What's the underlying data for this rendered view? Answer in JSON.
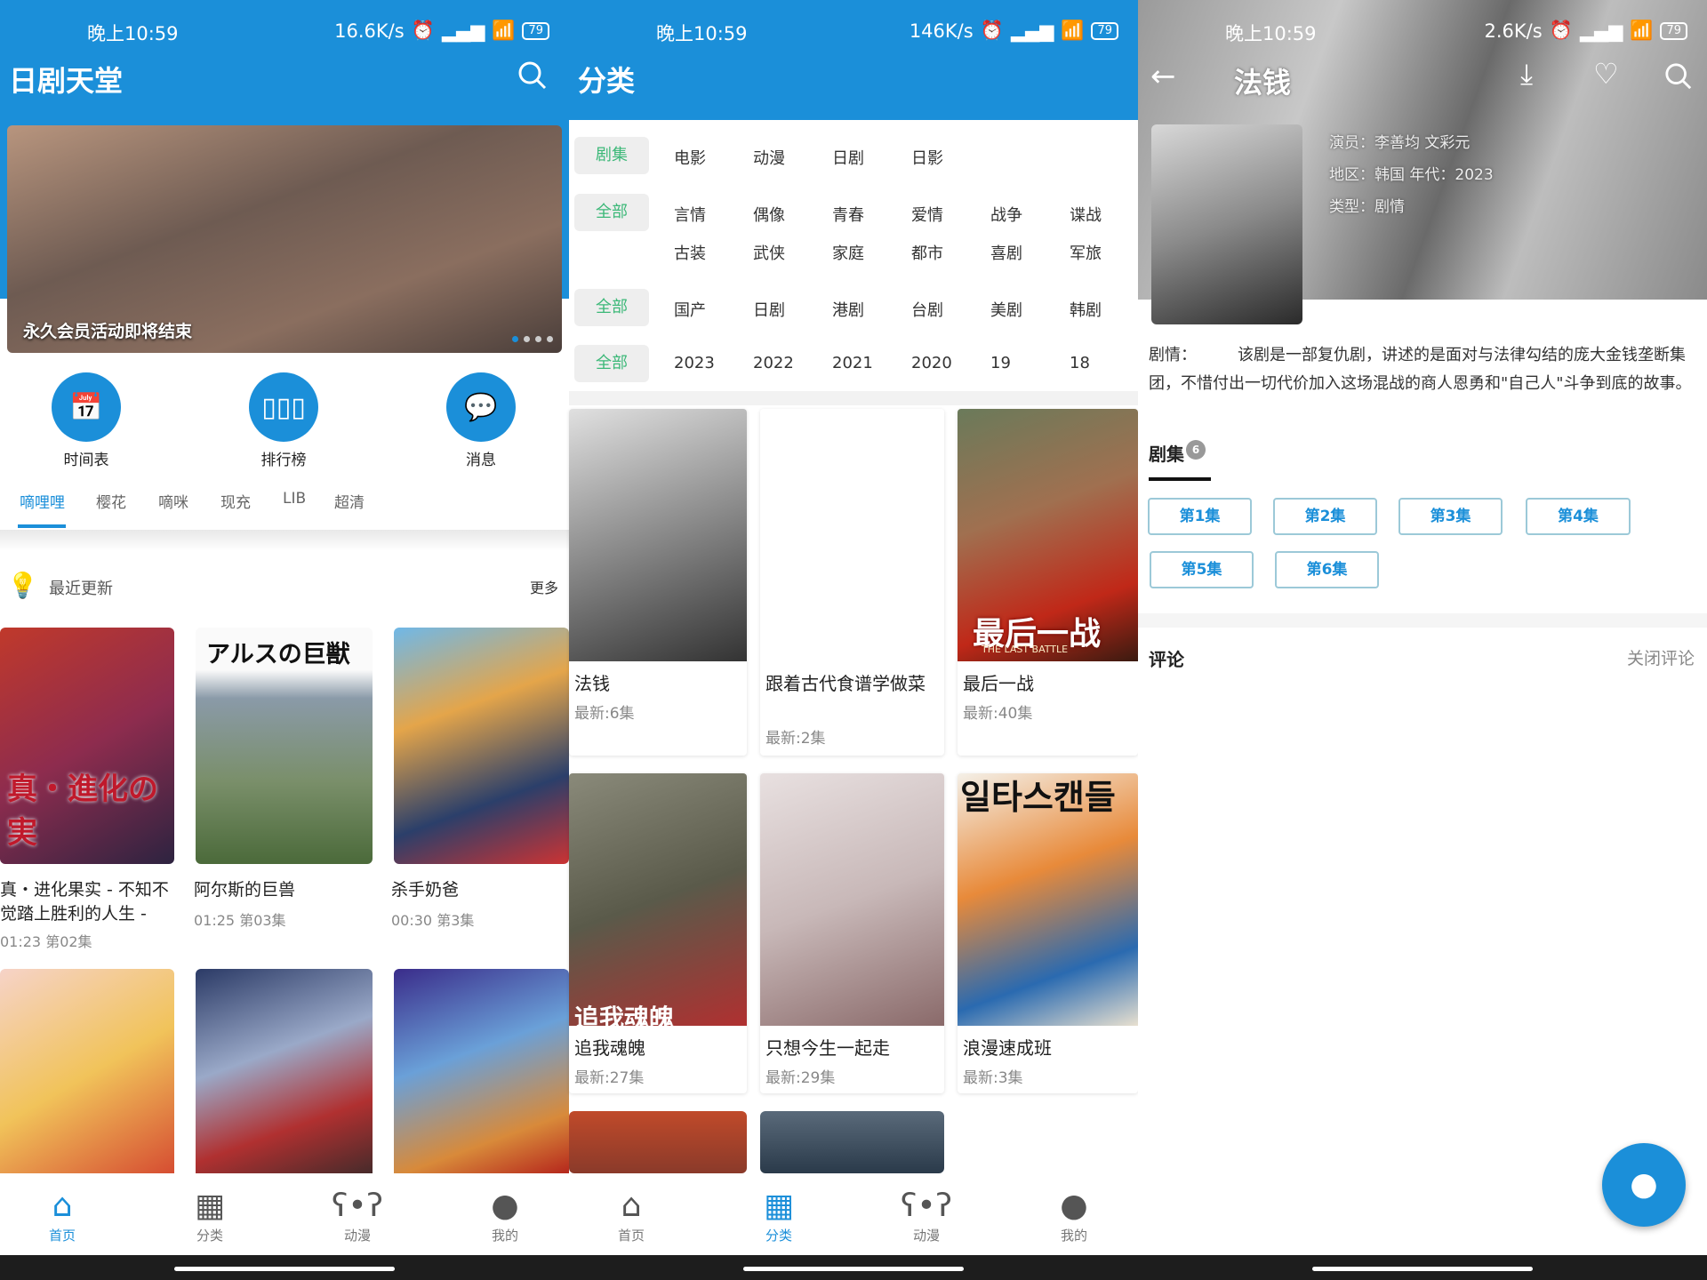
{
  "status": [
    {
      "time": "晚上10:59",
      "speed": "16.6K/s",
      "battery": "79"
    },
    {
      "time": "晚上10:59",
      "speed": "146K/s",
      "battery": "79"
    },
    {
      "time": "晚上10:59",
      "speed": "2.6K/s",
      "battery": "79"
    }
  ],
  "home": {
    "title": "日剧天堂",
    "banner_caption": "永久会员活动即将结束",
    "banner_dots": 4,
    "quick": [
      {
        "label": "时间表",
        "icon": "calendar-icon"
      },
      {
        "label": "排行榜",
        "icon": "chart-icon"
      },
      {
        "label": "消息",
        "icon": "message-icon"
      }
    ],
    "source_tabs": [
      "嘀哩哩",
      "樱花",
      "嘀咪",
      "现充",
      "LIB",
      "超清"
    ],
    "active_tab": "嘀哩哩",
    "section_title": "最近更新",
    "more": "更多",
    "items": [
      {
        "title": "真・进化果实 - 不知不觉踏上胜利的人生 -",
        "meta": "01:23 第02集"
      },
      {
        "title": "阿尔斯的巨兽",
        "meta": "01:25 第03集"
      },
      {
        "title": "杀手奶爸",
        "meta": "00:30 第3集"
      }
    ],
    "poster_text": [
      "真・進化の実",
      "アルスの巨獣"
    ]
  },
  "nav": [
    {
      "label": "首页",
      "icon": "home-icon"
    },
    {
      "label": "分类",
      "icon": "grid-icon"
    },
    {
      "label": "动漫",
      "icon": "bear-icon"
    },
    {
      "label": "我的",
      "icon": "user-icon"
    }
  ],
  "category": {
    "title": "分类",
    "rows": [
      {
        "chip": "剧集",
        "options": [
          "电影",
          "动漫",
          "日剧",
          "日影"
        ]
      },
      {
        "chip": "全部",
        "options": [
          "言情",
          "偶像",
          "青春",
          "爱情",
          "战争",
          "谍战",
          "古装",
          "武侠",
          "家庭",
          "都市",
          "喜剧",
          "军旅"
        ]
      },
      {
        "chip": "全部",
        "options": [
          "国产",
          "日剧",
          "港剧",
          "台剧",
          "美剧",
          "韩剧"
        ]
      },
      {
        "chip": "全部",
        "options": [
          "2023",
          "2022",
          "2021",
          "2020",
          "19",
          "18"
        ]
      }
    ],
    "items": [
      {
        "title": "法钱",
        "meta": "最新:6集"
      },
      {
        "title": "跟着古代食谱学做菜",
        "meta": "最新:2集"
      },
      {
        "title": "最后一战",
        "meta": "最新:40集"
      },
      {
        "title": "追我魂魄",
        "meta": "最新:27集"
      },
      {
        "title": "只想今生一起走",
        "meta": "最新:29集"
      },
      {
        "title": "浪漫速成班",
        "meta": "最新:3集"
      }
    ],
    "poster_text": [
      "最后一战",
      "THE LAST BATTLE",
      "追我魂魄",
      "일타스캔들"
    ]
  },
  "detail": {
    "title": "法钱",
    "actors": "演员：李善均 文彩元",
    "region_year": "地区：韩国 年代：2023",
    "genre": "类型：剧情",
    "plot_label": "剧情：",
    "plot": "该剧是一部复仇剧，讲述的是面对与法律勾结的庞大金钱垄断集团，不惜付出一切代价加入这场混战的商人恩勇和\"自己人\"斗争到底的故事。",
    "episodes_tab": "剧集",
    "episode_count": "6",
    "episodes": [
      "第1集",
      "第2集",
      "第3集",
      "第4集",
      "第5集",
      "第6集"
    ],
    "comments": "评论",
    "close_comments": "关闭评论"
  },
  "colors": {
    "primary": "#1b8fd9",
    "chip_text": "#3cb878"
  }
}
